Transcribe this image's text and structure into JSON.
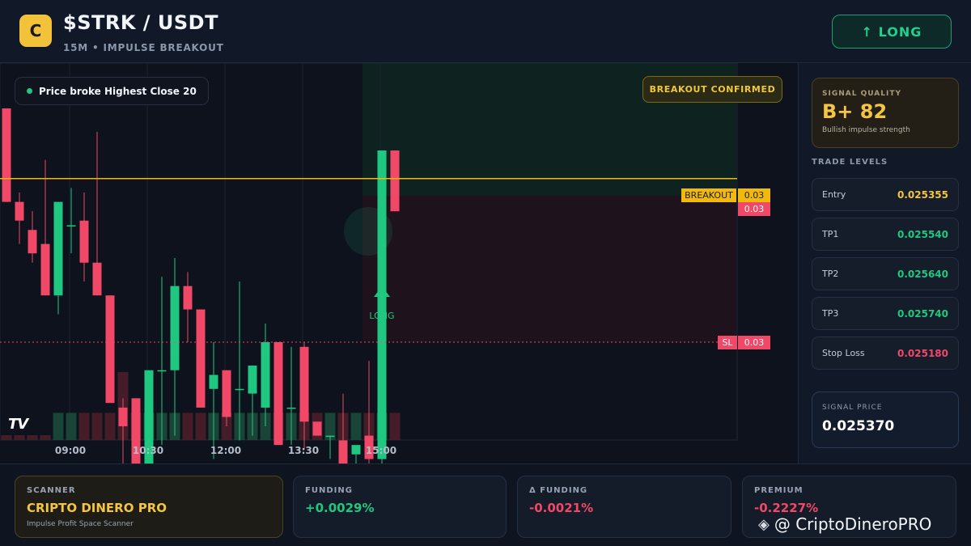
{
  "header": {
    "logo_letter": "C",
    "pair": "$STRK / USDT",
    "subtitle": "15M • IMPULSE BREAKOUT",
    "long_button": "↑ LONG"
  },
  "chart": {
    "chip_text": "Price broke Highest Close 20",
    "confirm_badge": "BREAKOUT CONFIRMED",
    "breakout_label": "BREAKOUT",
    "breakout_price_tag": "0.03",
    "current_price_tag": "0.03",
    "sl_label": "SL",
    "sl_price_tag": "0.03",
    "long_marker": "LONG",
    "tv_logo": "TV",
    "time_labels": [
      "09:00",
      "10:30",
      "12:00",
      "13:30",
      "15:00"
    ],
    "up_color": "#20c781",
    "down_color": "#f04866",
    "level_color": "#f0b90b"
  },
  "chart_data": {
    "type": "candlestick",
    "title": "$STRK / USDT",
    "x_ticks": [
      "09:00",
      "10:30",
      "12:00",
      "13:30",
      "15:00"
    ],
    "levels": [
      {
        "name": "BREAKOUT",
        "value": 0.025355
      },
      {
        "name": "SL",
        "value": 0.02518
      }
    ],
    "candles": [
      {
        "o": 0.02543,
        "h": 0.02543,
        "l": 0.02533,
        "c": 0.02533,
        "v": 0
      },
      {
        "o": 0.02533,
        "h": 0.02534,
        "l": 0.025285,
        "c": 0.02531,
        "v": 0
      },
      {
        "o": 0.0253,
        "h": 0.02532,
        "l": 0.025265,
        "c": 0.025275,
        "v": 0
      },
      {
        "o": 0.025285,
        "h": 0.025375,
        "l": 0.02523,
        "c": 0.02523,
        "v": 0
      },
      {
        "o": 0.02523,
        "h": 0.02533,
        "l": 0.02521,
        "c": 0.02533,
        "v": 4
      },
      {
        "o": 0.025305,
        "h": 0.025345,
        "l": 0.025275,
        "c": 0.025305,
        "v": 4
      },
      {
        "o": 0.02531,
        "h": 0.02534,
        "l": 0.025245,
        "c": 0.025265,
        "v": 4
      },
      {
        "o": 0.025265,
        "h": 0.025405,
        "l": 0.02523,
        "c": 0.02523,
        "v": 4
      },
      {
        "o": 0.02523,
        "h": 0.02523,
        "l": 0.025115,
        "c": 0.025115,
        "v": 4
      },
      {
        "o": 0.02511,
        "h": 0.02512,
        "l": 0.024945,
        "c": 0.02509,
        "v": 10
      },
      {
        "o": 0.02512,
        "h": 0.02512,
        "l": 0.024995,
        "c": 0.025,
        "v": 4
      },
      {
        "o": 0.02503,
        "h": 0.02515,
        "l": 0.02501,
        "c": 0.02515,
        "v": 4
      },
      {
        "o": 0.02515,
        "h": 0.02525,
        "l": 0.02507,
        "c": 0.02515,
        "v": 4
      },
      {
        "o": 0.02515,
        "h": 0.02527,
        "l": 0.02508,
        "c": 0.02524,
        "v": 4
      },
      {
        "o": 0.02524,
        "h": 0.025255,
        "l": 0.02518,
        "c": 0.025215,
        "v": 4
      },
      {
        "o": 0.025215,
        "h": 0.025215,
        "l": 0.02511,
        "c": 0.02511,
        "v": 4
      },
      {
        "o": 0.02513,
        "h": 0.02518,
        "l": 0.025055,
        "c": 0.025145,
        "v": 4
      },
      {
        "o": 0.02515,
        "h": 0.02515,
        "l": 0.02509,
        "c": 0.0251,
        "v": 4
      },
      {
        "o": 0.02513,
        "h": 0.025245,
        "l": 0.025075,
        "c": 0.02513,
        "v": 4
      },
      {
        "o": 0.025125,
        "h": 0.025155,
        "l": 0.02508,
        "c": 0.025155,
        "v": 4
      },
      {
        "o": 0.02511,
        "h": 0.0252,
        "l": 0.02509,
        "c": 0.02518,
        "v": 4
      },
      {
        "o": 0.02518,
        "h": 0.02518,
        "l": 0.02507,
        "c": 0.02507,
        "v": 4
      },
      {
        "o": 0.02511,
        "h": 0.025175,
        "l": 0.02507,
        "c": 0.02511,
        "v": 4
      },
      {
        "o": 0.025175,
        "h": 0.02518,
        "l": 0.025065,
        "c": 0.025095,
        "v": 4
      },
      {
        "o": 0.025095,
        "h": 0.025095,
        "l": 0.02508,
        "c": 0.02508,
        "v": 4
      },
      {
        "o": 0.02508,
        "h": 0.02508,
        "l": 0.025055,
        "c": 0.02508,
        "v": 4
      },
      {
        "o": 0.025075,
        "h": 0.025125,
        "l": 0.02499,
        "c": 0.025,
        "v": 4
      },
      {
        "o": 0.02506,
        "h": 0.02506,
        "l": 0.024995,
        "c": 0.02507,
        "v": 4
      },
      {
        "o": 0.02508,
        "h": 0.02516,
        "l": 0.02504,
        "c": 0.025055,
        "v": 4
      },
      {
        "o": 0.025055,
        "h": 0.025385,
        "l": 0.02497,
        "c": 0.025385,
        "v": 4
      },
      {
        "o": 0.025385,
        "h": 0.025385,
        "l": 0.02532,
        "c": 0.02532,
        "v": 4
      }
    ]
  },
  "sidebar": {
    "quality_label": "SIGNAL QUALITY",
    "quality_grade": "B+ 82",
    "quality_note": "Bullish impulse strength",
    "levels_title": "TRADE LEVELS",
    "levels": [
      {
        "name": "Entry",
        "value": "0.025355",
        "color": "#f4c542"
      },
      {
        "name": "TP1",
        "value": "0.025540",
        "color": "#20c781"
      },
      {
        "name": "TP2",
        "value": "0.025640",
        "color": "#20c781"
      },
      {
        "name": "TP3",
        "value": "0.025740",
        "color": "#20c781"
      },
      {
        "name": "Stop Loss",
        "value": "0.025180",
        "color": "#f04866"
      }
    ],
    "signal_price_label": "SIGNAL PRICE",
    "signal_price": "0.025370"
  },
  "footer": {
    "scanner_label": "SCANNER",
    "scanner_name": "CRIPTO DINERO PRO",
    "scanner_note": "Impulse Profit Space Scanner",
    "funding_label": "FUNDING",
    "funding_value": "+0.0029%",
    "dfunding_label": "Δ FUNDING",
    "dfunding_value": "-0.0021%",
    "premium_label": "PREMIUM",
    "premium_value": "-0.2227%",
    "watermark": "@ CriptoDineroPRO"
  }
}
